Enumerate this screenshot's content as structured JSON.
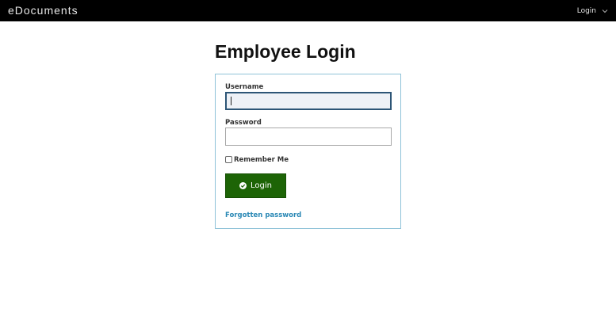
{
  "header": {
    "brand": "eDocuments",
    "nav_login_label": "Login"
  },
  "page": {
    "title": "Employee Login"
  },
  "form": {
    "username_label": "Username",
    "username_value": "",
    "password_label": "Password",
    "password_value": "",
    "remember_label": "Remember Me",
    "remember_checked": false,
    "login_button_label": "Login",
    "forgot_label": "Forgotten password"
  },
  "colors": {
    "topbar": "#000000",
    "button": "#1d6406",
    "link": "#2a88b5",
    "panel_border": "#8fc3d8"
  }
}
